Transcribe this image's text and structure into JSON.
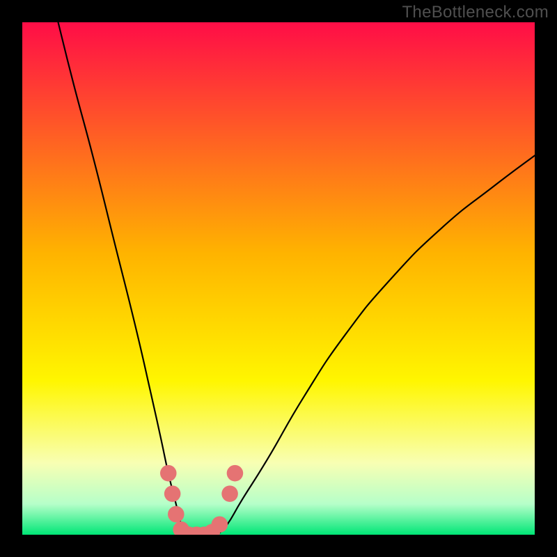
{
  "watermark": "TheBottleneck.com",
  "chart_data": {
    "type": "line",
    "title": "",
    "xlabel": "",
    "ylabel": "",
    "xlim": [
      0,
      100
    ],
    "ylim": [
      0,
      100
    ],
    "grid": false,
    "legend": false,
    "background": {
      "kind": "vertical-gradient",
      "stops": [
        {
          "pos": 0.0,
          "color": "#ff0d47"
        },
        {
          "pos": 0.45,
          "color": "#ffb300"
        },
        {
          "pos": 0.7,
          "color": "#fff600"
        },
        {
          "pos": 0.86,
          "color": "#f8ffb3"
        },
        {
          "pos": 0.94,
          "color": "#b6ffc9"
        },
        {
          "pos": 1.0,
          "color": "#00e676"
        }
      ]
    },
    "series": [
      {
        "name": "left-branch",
        "x": [
          7,
          10,
          14,
          18,
          22,
          25,
          27,
          28.5,
          30,
          31,
          32
        ],
        "y": [
          100,
          88,
          73,
          57,
          41,
          28,
          19,
          12,
          6,
          2,
          0
        ],
        "color": "#000000"
      },
      {
        "name": "right-branch",
        "x": [
          38,
          40,
          43,
          48,
          55,
          63,
          72,
          82,
          92,
          100
        ],
        "y": [
          0,
          2,
          7,
          15,
          27,
          39,
          50,
          60,
          68,
          74
        ],
        "color": "#000000"
      },
      {
        "name": "floor",
        "x": [
          32,
          34,
          36,
          38
        ],
        "y": [
          0,
          0,
          0,
          0
        ],
        "color": "#000000"
      }
    ],
    "markers": {
      "name": "valley-dots",
      "color": "#e57373",
      "radius_pct": 1.6,
      "points": [
        {
          "x": 28.5,
          "y": 12
        },
        {
          "x": 29.3,
          "y": 8
        },
        {
          "x": 30.0,
          "y": 4
        },
        {
          "x": 31.0,
          "y": 1
        },
        {
          "x": 32.5,
          "y": 0
        },
        {
          "x": 34.0,
          "y": 0
        },
        {
          "x": 35.5,
          "y": 0
        },
        {
          "x": 37.0,
          "y": 0.5
        },
        {
          "x": 38.5,
          "y": 2
        },
        {
          "x": 40.5,
          "y": 8
        },
        {
          "x": 41.5,
          "y": 12
        }
      ]
    }
  }
}
